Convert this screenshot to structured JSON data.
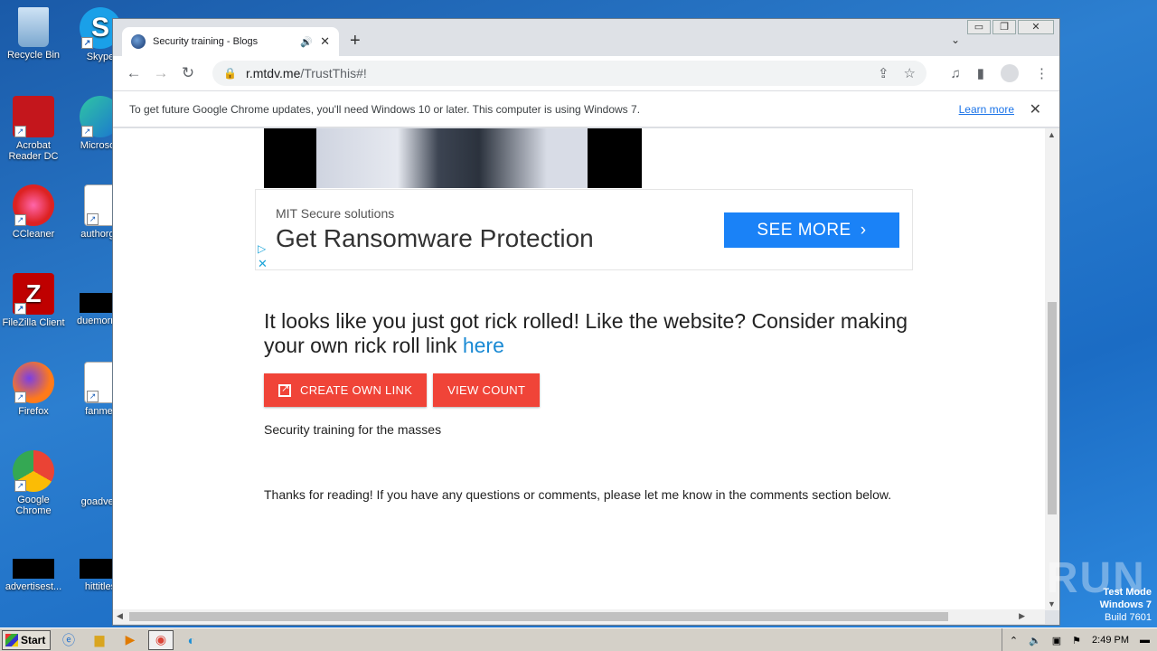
{
  "desktop": {
    "icons": [
      {
        "label": "Recycle Bin"
      },
      {
        "label": "Skype"
      },
      {
        "label": "Acrobat Reader DC"
      },
      {
        "label": "Microsoft"
      },
      {
        "label": "CCleaner"
      },
      {
        "label": "authorgo"
      },
      {
        "label": "FileZilla Client"
      },
      {
        "label": "duemornin"
      },
      {
        "label": "Firefox"
      },
      {
        "label": "fanmet"
      },
      {
        "label": "Google Chrome"
      },
      {
        "label": "goadvert"
      },
      {
        "label": "advertisest..."
      },
      {
        "label": "hittitles"
      }
    ],
    "watermark": "ANY RUN",
    "testmode": {
      "line1": "Test Mode",
      "line2": "Windows 7",
      "line3": "Build 7601"
    }
  },
  "browser": {
    "tab_title": "Security training - Blogs",
    "url_host": "r.mtdv.me",
    "url_path": "/TrustThis#!",
    "infobar_text": "To get future Google Chrome updates, you'll need Windows 10 or later. This computer is using Windows 7.",
    "infobar_link": "Learn more"
  },
  "ad": {
    "sponsor": "MIT Secure solutions",
    "headline": "Get Ransomware Protection",
    "cta": "SEE MORE"
  },
  "content": {
    "message": "It looks like you just got rick rolled! Like the website? Consider making your own rick roll link",
    "message_link": "here",
    "create_button": "CREATE OWN LINK",
    "view_button": "VIEW COUNT",
    "tagline": "Security training for the masses",
    "thanks": "Thanks for reading! If you have any questions or comments, please let me know in the comments section below."
  },
  "taskbar": {
    "start_label": "Start",
    "clock": "2:49 PM"
  }
}
